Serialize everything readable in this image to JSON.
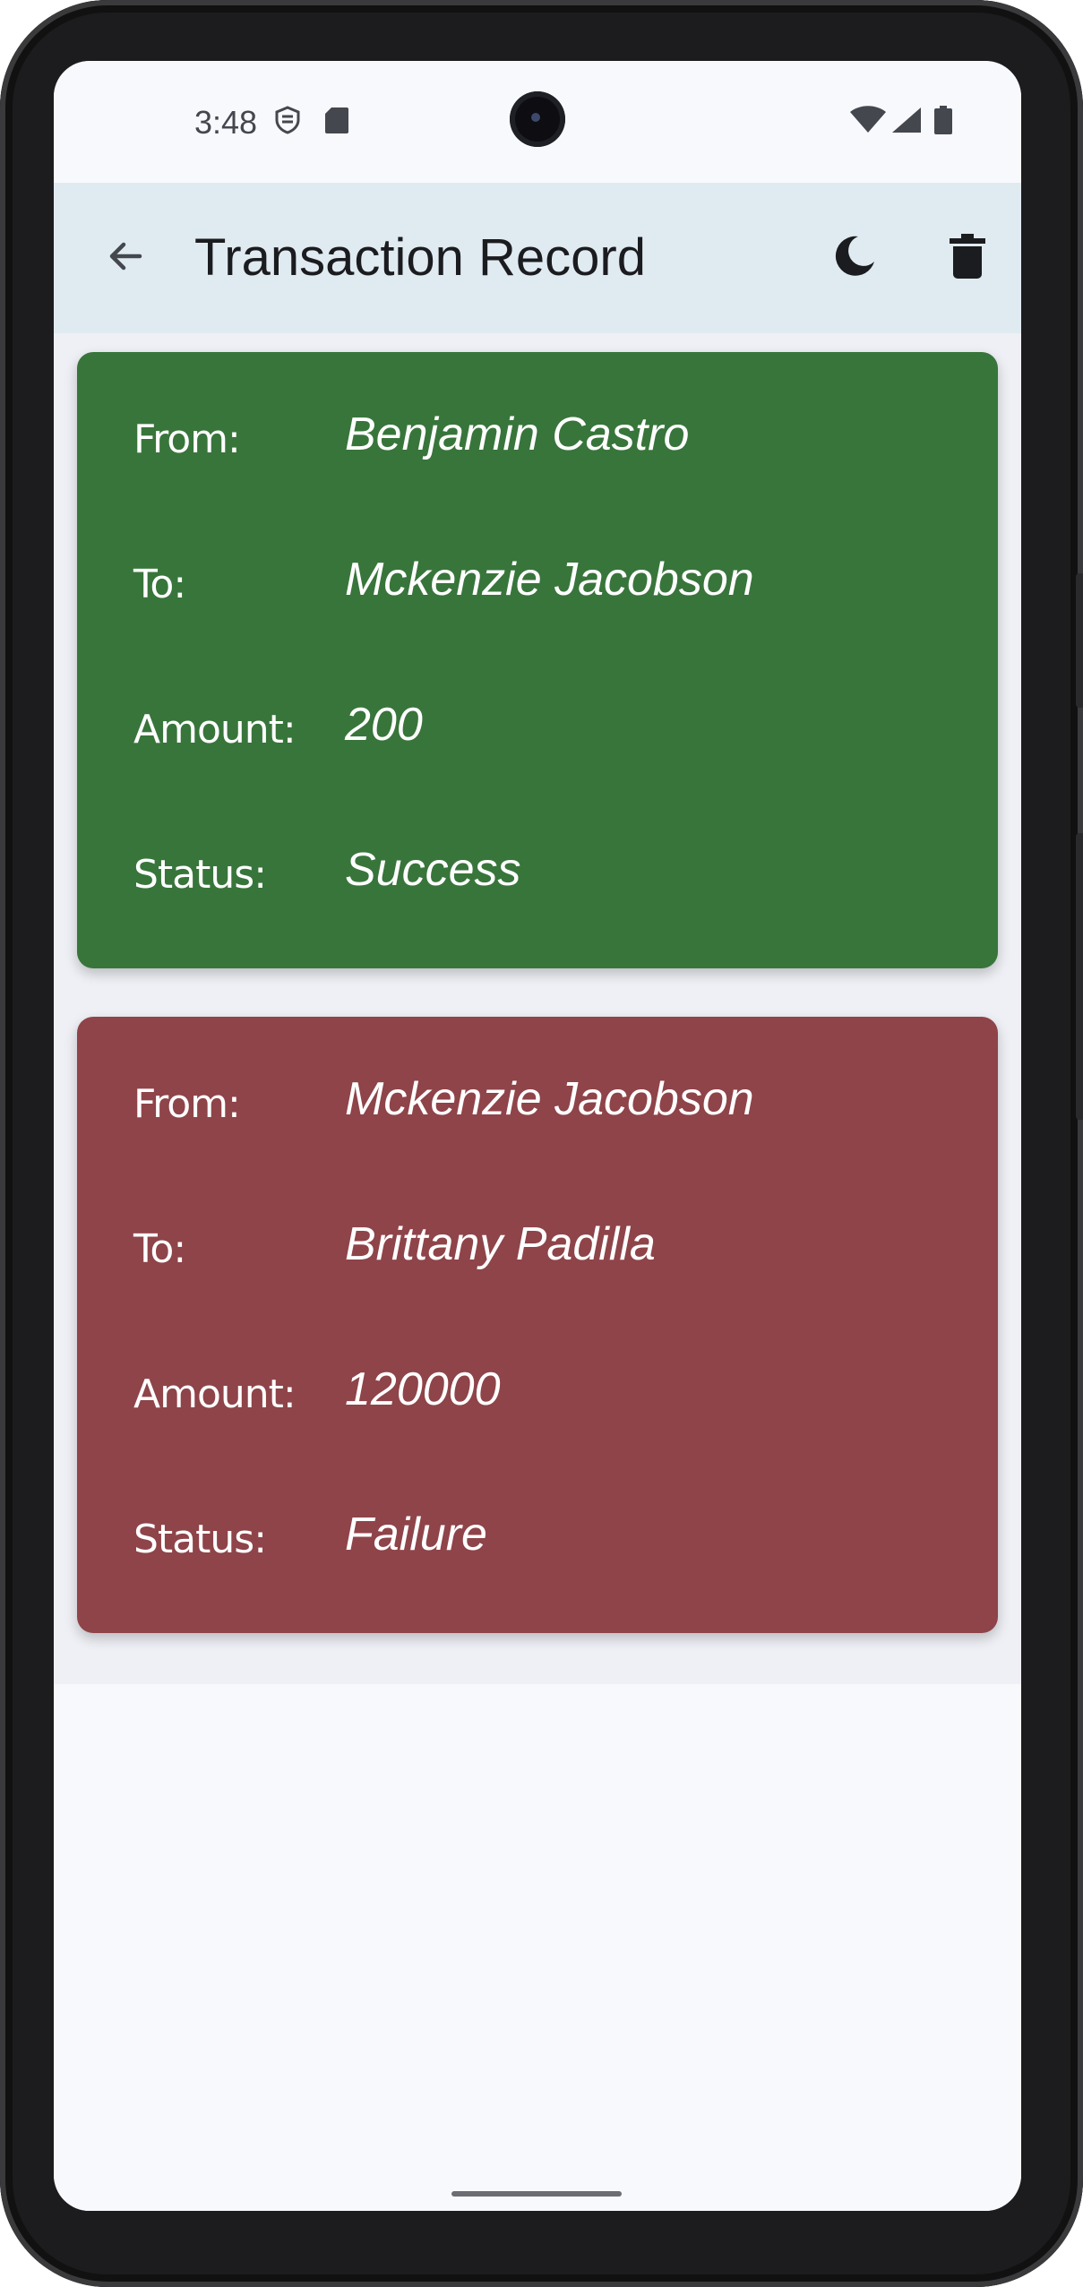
{
  "status_bar": {
    "time": "3:48",
    "icons": [
      "shield-icon",
      "sd-card-icon",
      "wifi-icon",
      "signal-icon",
      "battery-icon"
    ]
  },
  "app_bar": {
    "title": "Transaction Record",
    "back_icon": "arrow-back-icon",
    "theme_icon": "moon-icon",
    "delete_icon": "trash-icon"
  },
  "labels": {
    "from": "From:",
    "to": "To:",
    "amount": "Amount:",
    "status": "Status:"
  },
  "transactions": [
    {
      "from": "Benjamin Castro",
      "to": "Mckenzie Jacobson",
      "amount": "200",
      "status": "Success",
      "color": "#38753b"
    },
    {
      "from": "Mckenzie Jacobson",
      "to": "Brittany Padilla",
      "amount": "120000",
      "status": "Failure",
      "color": "#8e4449"
    }
  ],
  "colors": {
    "app_bar_bg": "#e0ebf1",
    "screen_bg": "#f8f9fd",
    "success": "#38753b",
    "failure": "#8e4449"
  }
}
